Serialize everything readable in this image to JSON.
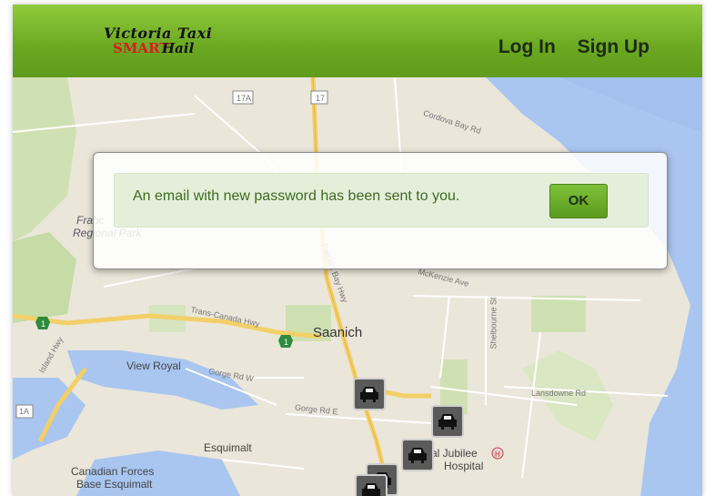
{
  "header": {
    "logo_line1": "Victoria Taxi",
    "logo_line2_a": "SMART",
    "logo_line2_b": "Hail",
    "login_label": "Log In",
    "signup_label": "Sign Up",
    "accent_color": "#6aa821"
  },
  "dialog": {
    "message": "An email with new password has been sent to you.",
    "ok_label": "OK"
  },
  "map": {
    "labels": {
      "francis_1": "Franc",
      "francis_2": "Regional Park",
      "saanich": "Saanich",
      "view_royal": "View Royal",
      "esquimalt": "Esquimalt",
      "cfb_1": "Canadian Forces",
      "cfb_2": "Base Esquimalt",
      "royal_jubilee_1": "al Jubilee",
      "royal_jubilee_2": "Hospital",
      "trans_canada": "Trans-Canada Hwy",
      "cordova": "Cordova Bay Rd",
      "mckenzie": "McKenzie Ave",
      "gorge_w": "Gorge Rd W",
      "gorge_e": "Gorge Rd E",
      "lansdowne": "Lansdowne Rd",
      "shelbourne": "Shelbourne St",
      "island_hwy": "Island Hwy",
      "patricia_bay": "Patricia Bay Hwy",
      "hwy_17a": "17A",
      "hwy_17": "17",
      "hwy_1a": "1A",
      "hwy_1": "1"
    }
  }
}
